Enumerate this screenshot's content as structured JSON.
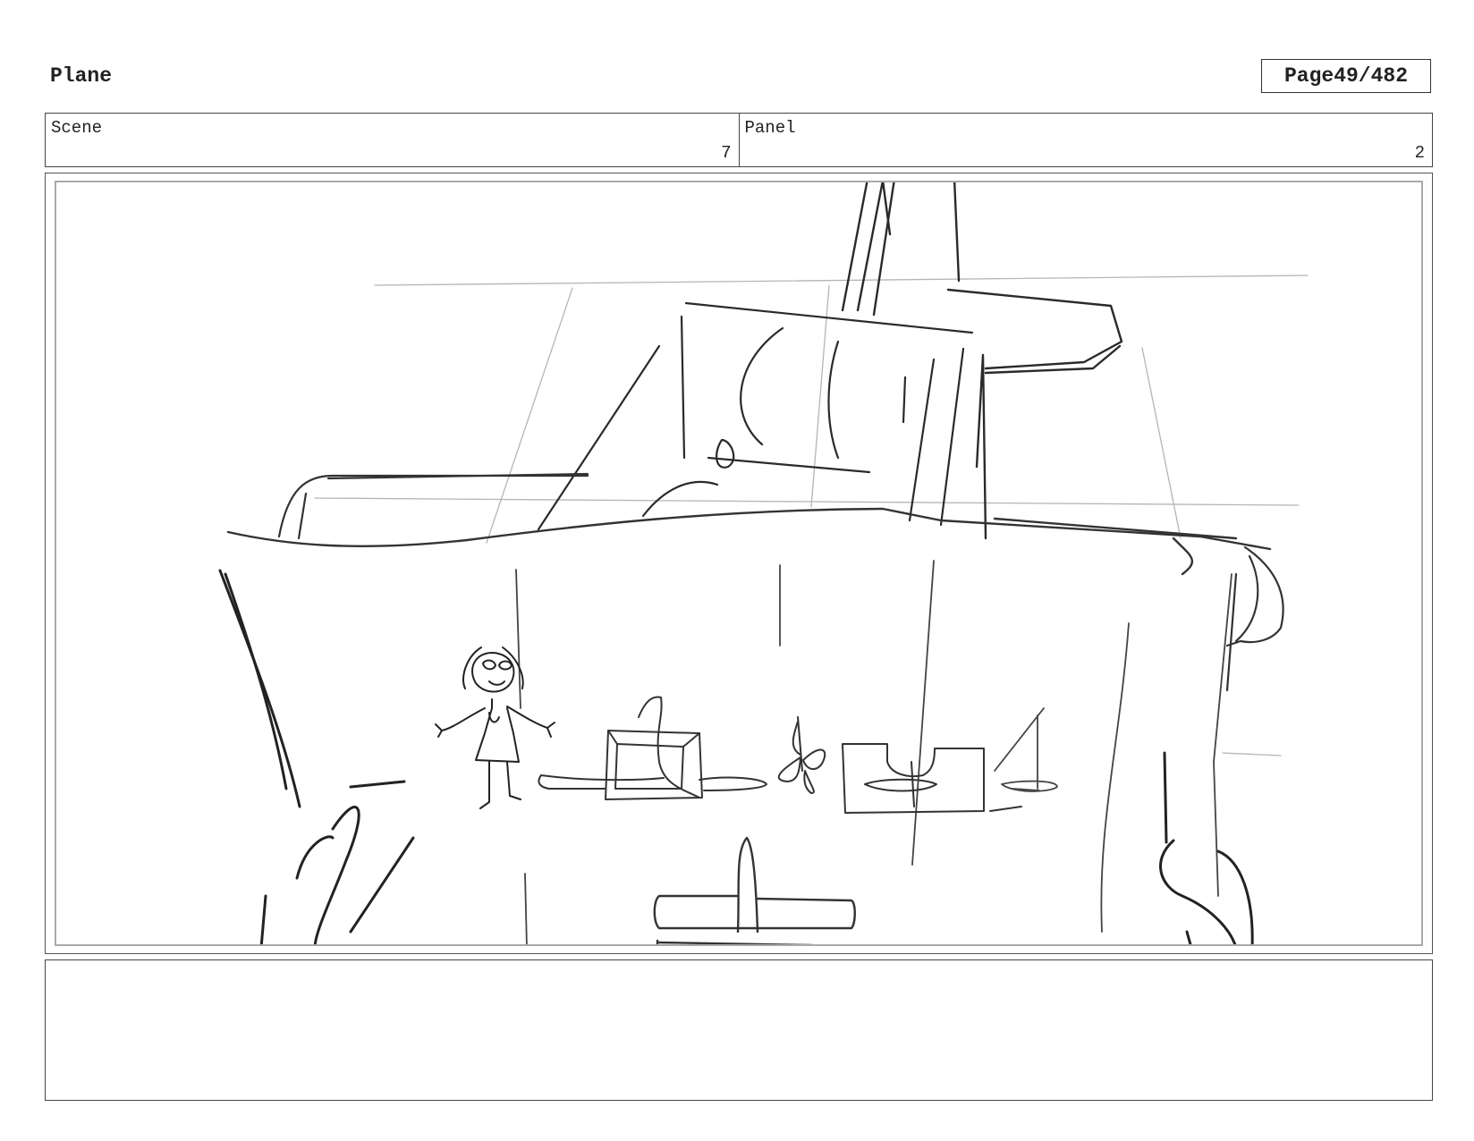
{
  "header": {
    "title": "Plane",
    "page_label": "Page",
    "page_number": "49/482"
  },
  "info": {
    "scene_label": "Scene",
    "scene_value": "7",
    "panel_label": "Panel",
    "panel_value": "2"
  },
  "notes": {
    "text": ""
  }
}
